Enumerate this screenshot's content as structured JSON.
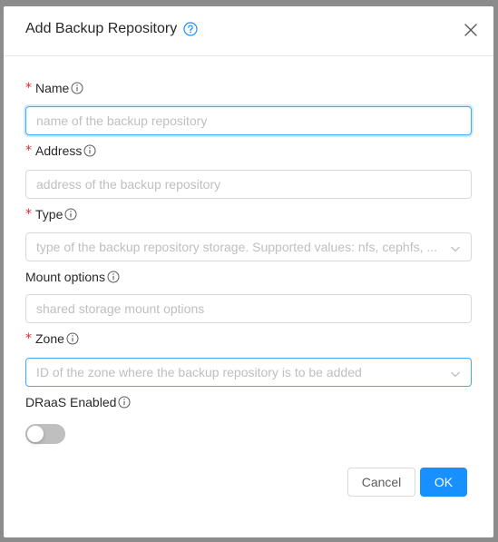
{
  "dialog": {
    "title": "Add Backup Repository",
    "help_icon": "question-circle-icon",
    "close_icon": "close-icon"
  },
  "form": {
    "name": {
      "label": "Name",
      "required_mark": "*",
      "placeholder": "name of the backup repository",
      "info_icon": "info-circle-icon",
      "focused": true
    },
    "address": {
      "label": "Address",
      "required_mark": "*",
      "placeholder": "address of the backup repository",
      "info_icon": "info-circle-icon"
    },
    "type": {
      "label": "Type",
      "required_mark": "*",
      "placeholder": "type of the backup repository storage. Supported values: nfs, cephfs, ...",
      "info_icon": "info-circle-icon",
      "chevron_icon": "chevron-down-icon"
    },
    "mount_options": {
      "label": "Mount options",
      "placeholder": "shared storage mount options",
      "info_icon": "info-circle-icon"
    },
    "zone": {
      "label": "Zone",
      "required_mark": "*",
      "placeholder": "ID of the zone where the backup repository is to be added",
      "info_icon": "info-circle-icon",
      "chevron_icon": "chevron-down-icon"
    },
    "draas": {
      "label": "DRaaS Enabled",
      "info_icon": "info-circle-icon",
      "enabled": false
    }
  },
  "footer": {
    "cancel_label": "Cancel",
    "ok_label": "OK"
  },
  "colors": {
    "primary": "#1890ff",
    "required": "#f5222d",
    "placeholder": "#bfbfbf",
    "switch_off": "#bfbfbf"
  }
}
